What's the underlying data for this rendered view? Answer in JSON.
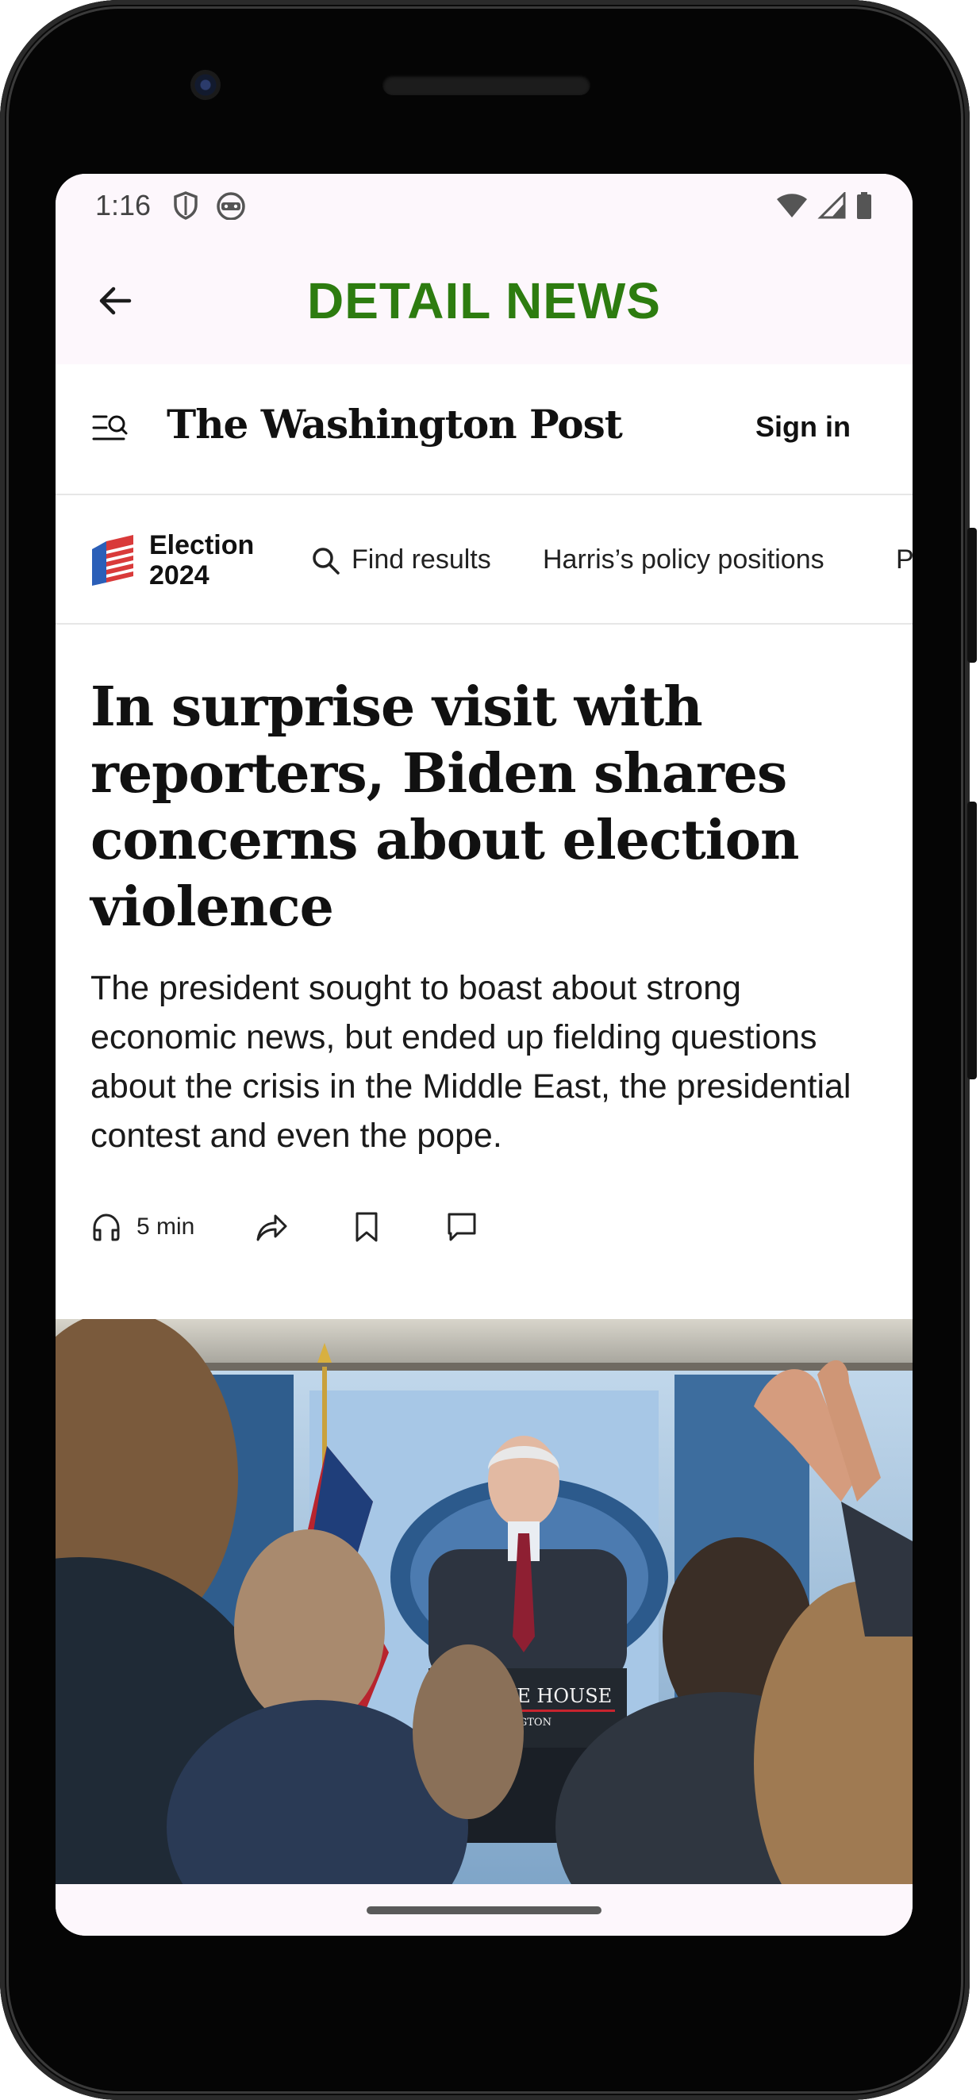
{
  "status_bar": {
    "time": "1:16",
    "left_icons": [
      "shield-icon",
      "android-robot-icon"
    ],
    "right_icons": [
      "wifi-icon",
      "cellular-signal-icon",
      "battery-icon"
    ]
  },
  "app_bar": {
    "title": "DETAIL NEWS",
    "title_color": "#2d7c10",
    "back_icon": "arrow-left-icon"
  },
  "wp_header": {
    "menu_icon": "menu-search-icon",
    "logo_text": "The Washington Post",
    "sign_in_label": "Sign in"
  },
  "nav_strip": {
    "election_label_line1": "Election",
    "election_label_line2": "2024",
    "search_icon": "search-icon",
    "items": [
      {
        "label": "Find results"
      },
      {
        "label": "Harris’s policy positions"
      },
      {
        "label": "P"
      }
    ]
  },
  "article": {
    "headline": "In surprise visit with reporters, Biden shares concerns about election violence",
    "dek": "The president sought to boast about strong economic news, but ended up fielding questions about the crisis in the Middle East, the presidential contest and even the pope.",
    "listen_time": "5 min",
    "actions": [
      "headphones-icon",
      "share-icon",
      "bookmark-icon",
      "comment-icon"
    ],
    "photo": {
      "podium_line1": "E WHITE HOUSE",
      "podium_line2": "WASHINGTON",
      "seal_text": "SE"
    }
  }
}
